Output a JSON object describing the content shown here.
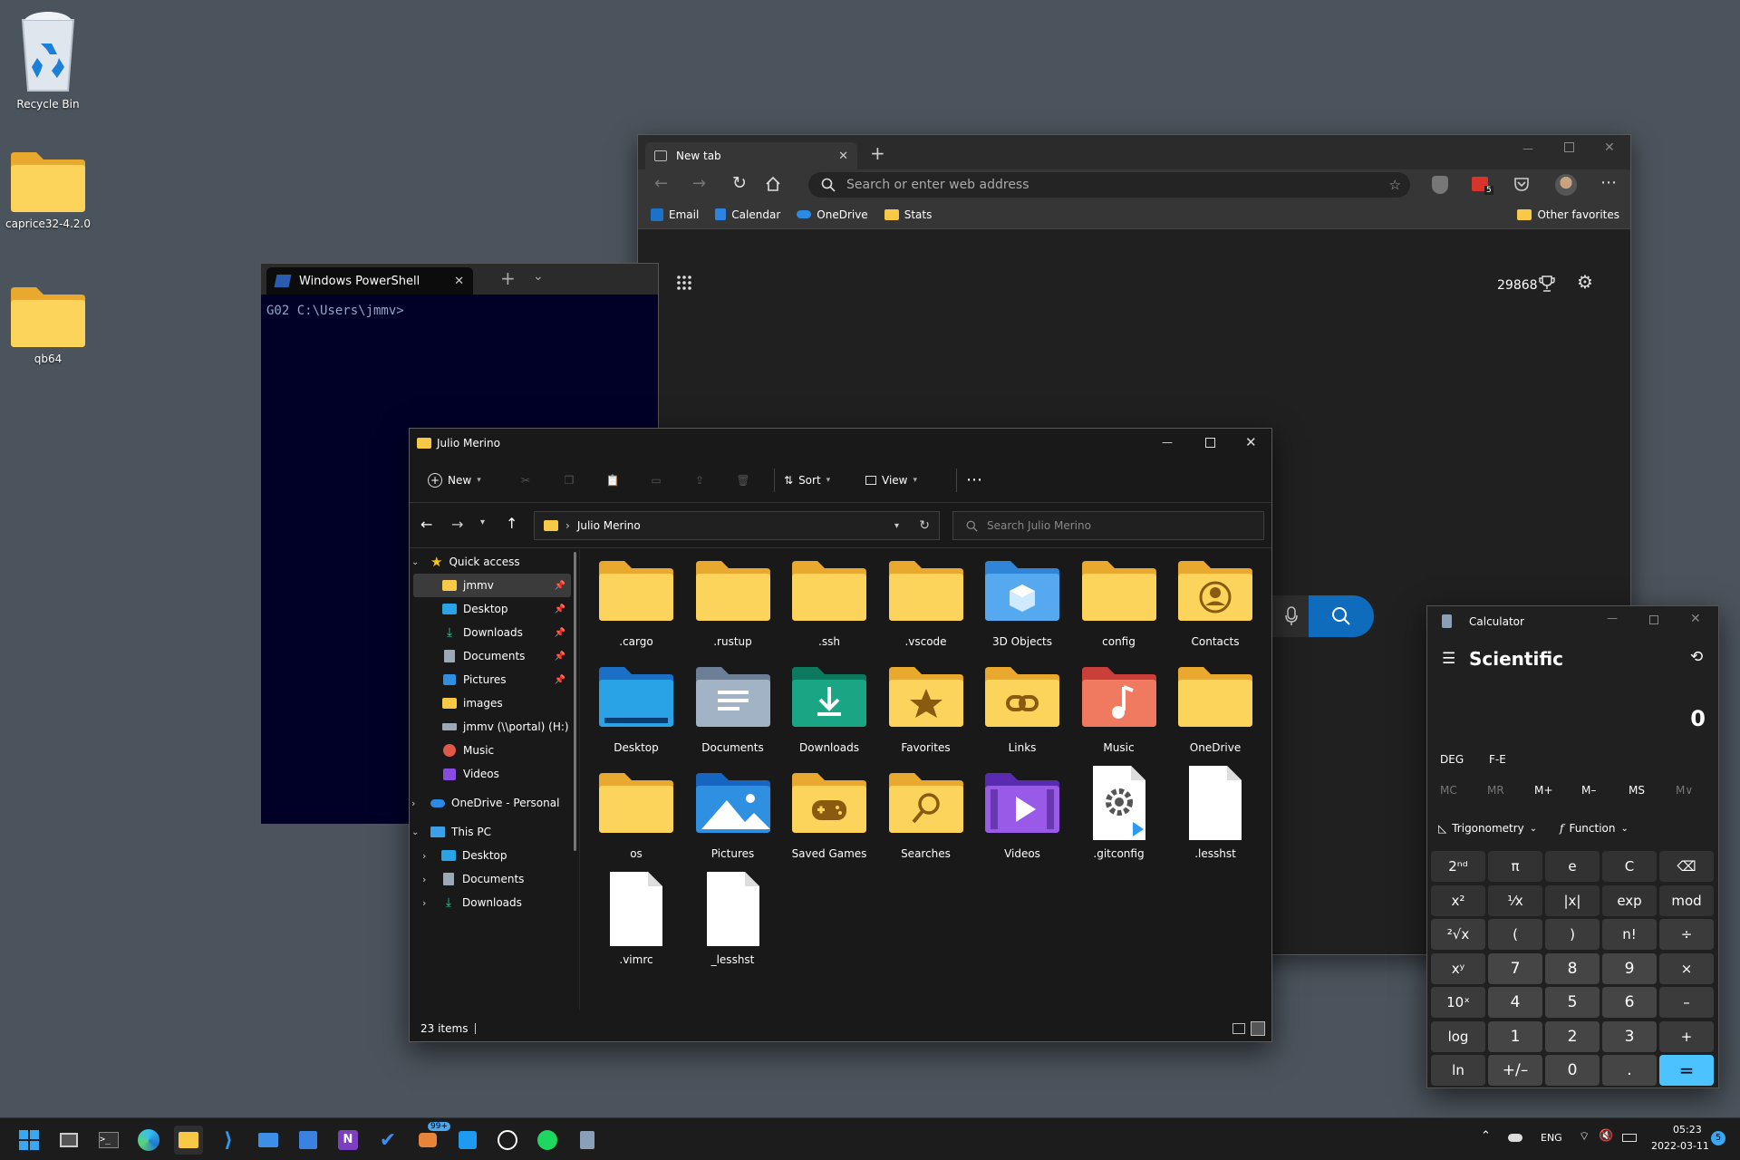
{
  "desktop": {
    "icons": [
      {
        "label": "Recycle Bin"
      },
      {
        "label": "caprice32-4.2.0"
      },
      {
        "label": "qb64"
      }
    ]
  },
  "browser": {
    "tab_title": "New tab",
    "address_placeholder": "Search or enter web address",
    "favorites": [
      {
        "label": "Email"
      },
      {
        "label": "Calendar"
      },
      {
        "label": "OneDrive"
      },
      {
        "label": "Stats"
      }
    ],
    "other_favorites": "Other favorites",
    "rewards_points": "29868",
    "extension_badge": "5"
  },
  "terminal": {
    "tab_title": "Windows PowerShell",
    "prompt": "G02 C:\\Users\\jmmv>"
  },
  "explorer": {
    "title": "Julio Merino",
    "toolbar": {
      "new": "New",
      "sort": "Sort",
      "view": "View"
    },
    "path_segment": "Julio Merino",
    "search_placeholder": "Search Julio Merino",
    "nav": [
      {
        "label": "Quick access"
      },
      {
        "label": "jmmv"
      },
      {
        "label": "Desktop"
      },
      {
        "label": "Downloads"
      },
      {
        "label": "Documents"
      },
      {
        "label": "Pictures"
      },
      {
        "label": "images"
      },
      {
        "label": "jmmv (\\\\portal) (H:)"
      },
      {
        "label": "Music"
      },
      {
        "label": "Videos"
      },
      {
        "label": "OneDrive - Personal"
      },
      {
        "label": "This PC"
      },
      {
        "label": "Desktop"
      },
      {
        "label": "Documents"
      },
      {
        "label": "Downloads"
      }
    ],
    "items": [
      {
        "label": ".cargo"
      },
      {
        "label": ".rustup"
      },
      {
        "label": ".ssh"
      },
      {
        "label": ".vscode"
      },
      {
        "label": "3D Objects"
      },
      {
        "label": "config"
      },
      {
        "label": "Contacts"
      },
      {
        "label": "Desktop"
      },
      {
        "label": "Documents"
      },
      {
        "label": "Downloads"
      },
      {
        "label": "Favorites"
      },
      {
        "label": "Links"
      },
      {
        "label": "Music"
      },
      {
        "label": "OneDrive"
      },
      {
        "label": "os"
      },
      {
        "label": "Pictures"
      },
      {
        "label": "Saved Games"
      },
      {
        "label": "Searches"
      },
      {
        "label": "Videos"
      },
      {
        "label": ".gitconfig"
      },
      {
        "label": ".lesshst"
      },
      {
        "label": ".vimrc"
      },
      {
        "label": "_lesshst"
      }
    ],
    "status": "23 items"
  },
  "calculator": {
    "app_title": "Calculator",
    "mode": "Scientific",
    "display": "0",
    "angle_unit": "DEG",
    "fe": "F-E",
    "memory": [
      "MC",
      "MR",
      "M+",
      "M–",
      "MS",
      "M∨"
    ],
    "trig": "Trigonometry",
    "func": "Function",
    "keys": [
      [
        "2ⁿᵈ",
        "π",
        "e",
        "C",
        "⌫"
      ],
      [
        "x²",
        "¹⁄x",
        "|x|",
        "exp",
        "mod"
      ],
      [
        "²√x",
        "(",
        ")",
        "n!",
        "÷"
      ],
      [
        "xʸ",
        "7",
        "8",
        "9",
        "×"
      ],
      [
        "10ˣ",
        "4",
        "5",
        "6",
        "–"
      ],
      [
        "log",
        "1",
        "2",
        "3",
        "+"
      ],
      [
        "ln",
        "+/–",
        "0",
        ".",
        "="
      ]
    ]
  },
  "taskbar": {
    "chat_badge": "99+",
    "lang": "ENG",
    "time": "05:23",
    "date": "2022-03-11",
    "notif_count": "5"
  },
  "colors": {
    "desktop": "#4b545c",
    "accent": "#4cc2ff",
    "folder": "#f8c946"
  }
}
